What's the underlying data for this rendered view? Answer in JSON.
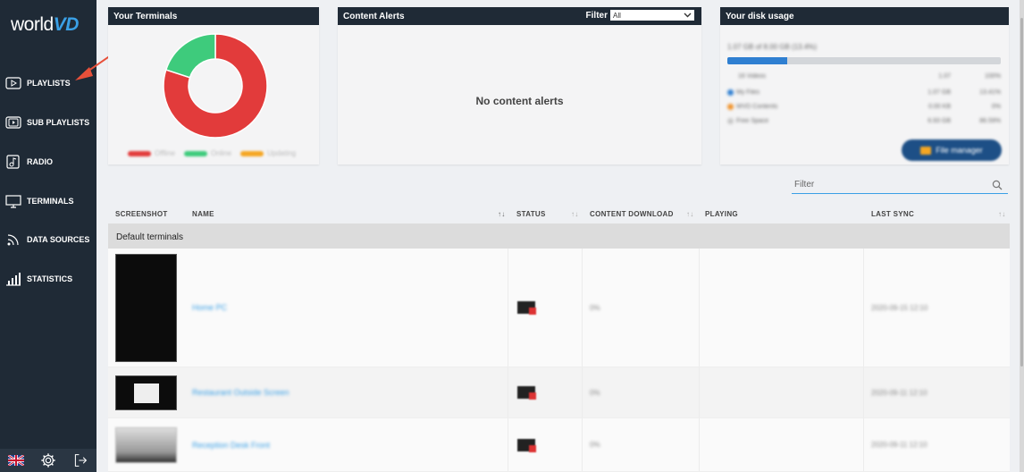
{
  "sidebar": {
    "logo": {
      "part1": "world",
      "part2": "VD"
    },
    "items": [
      {
        "label": "PLAYLISTS",
        "icon": "play-icon"
      },
      {
        "label": "SUB PLAYLISTS",
        "icon": "subplaylist-icon"
      },
      {
        "label": "RADIO",
        "icon": "radio-icon"
      },
      {
        "label": "TERMINALS",
        "icon": "monitor-icon"
      },
      {
        "label": "DATA SOURCES",
        "icon": "rss-icon"
      },
      {
        "label": "STATISTICS",
        "icon": "chart-icon"
      }
    ],
    "bottom": [
      "uk-flag-icon",
      "gear-icon",
      "logout-icon"
    ]
  },
  "terminals_card": {
    "title": "Your Terminals",
    "chart_data": {
      "type": "pie",
      "donut": true,
      "slices": [
        {
          "name": "Offline",
          "value": 80,
          "color": "#e23b3b"
        },
        {
          "name": "Online",
          "value": 20,
          "color": "#3ecb7c"
        },
        {
          "name": "Updating",
          "value": 0,
          "color": "#f5a623"
        }
      ]
    },
    "legend": [
      "Offline",
      "Online",
      "Updating"
    ]
  },
  "alerts_card": {
    "title": "Content Alerts",
    "filter_label": "Filter",
    "filter_value": "All",
    "empty_message": "No content alerts"
  },
  "disk_card": {
    "title": "Your disk usage",
    "summary": "1.07 GB of 8.00 GB (13.4%)",
    "fill_fraction": 0.22,
    "header": {
      "name": "16 Videos",
      "size": "1.07",
      "pct": "100%"
    },
    "rows": [
      {
        "label": "My Files",
        "size": "1.07 GB",
        "pct": "13.41%",
        "color": "#2f7fd1"
      },
      {
        "label": "WVD Contents",
        "size": "0.00 KB",
        "pct": "0%",
        "color": "#f0932b"
      },
      {
        "label": "Free Space",
        "size": "6.93 GB",
        "pct": "86.59%",
        "color": "#c8c8c8"
      }
    ],
    "button": "File manager"
  },
  "filter": {
    "placeholder": "Filter"
  },
  "table": {
    "headers": {
      "screenshot": "SCREENSHOT",
      "name": "NAME",
      "status": "STATUS",
      "download": "CONTENT DOWNLOAD",
      "playing": "PLAYING",
      "sync": "LAST SYNC"
    },
    "group": "Default terminals",
    "rows": [
      {
        "name": "Home PC",
        "download": "0%",
        "sync": "2020-09-15 12:10"
      },
      {
        "name": "Restaurant Outside Screen",
        "download": "0%",
        "sync": "2020-09-11 12:10"
      },
      {
        "name": "Reception Desk Front",
        "download": "0%",
        "sync": "2020-09-11 12:10"
      }
    ]
  },
  "colors": {
    "sidebar": "#1f2a36",
    "accent": "#3aa0e6",
    "arrow": "#e8503a"
  }
}
